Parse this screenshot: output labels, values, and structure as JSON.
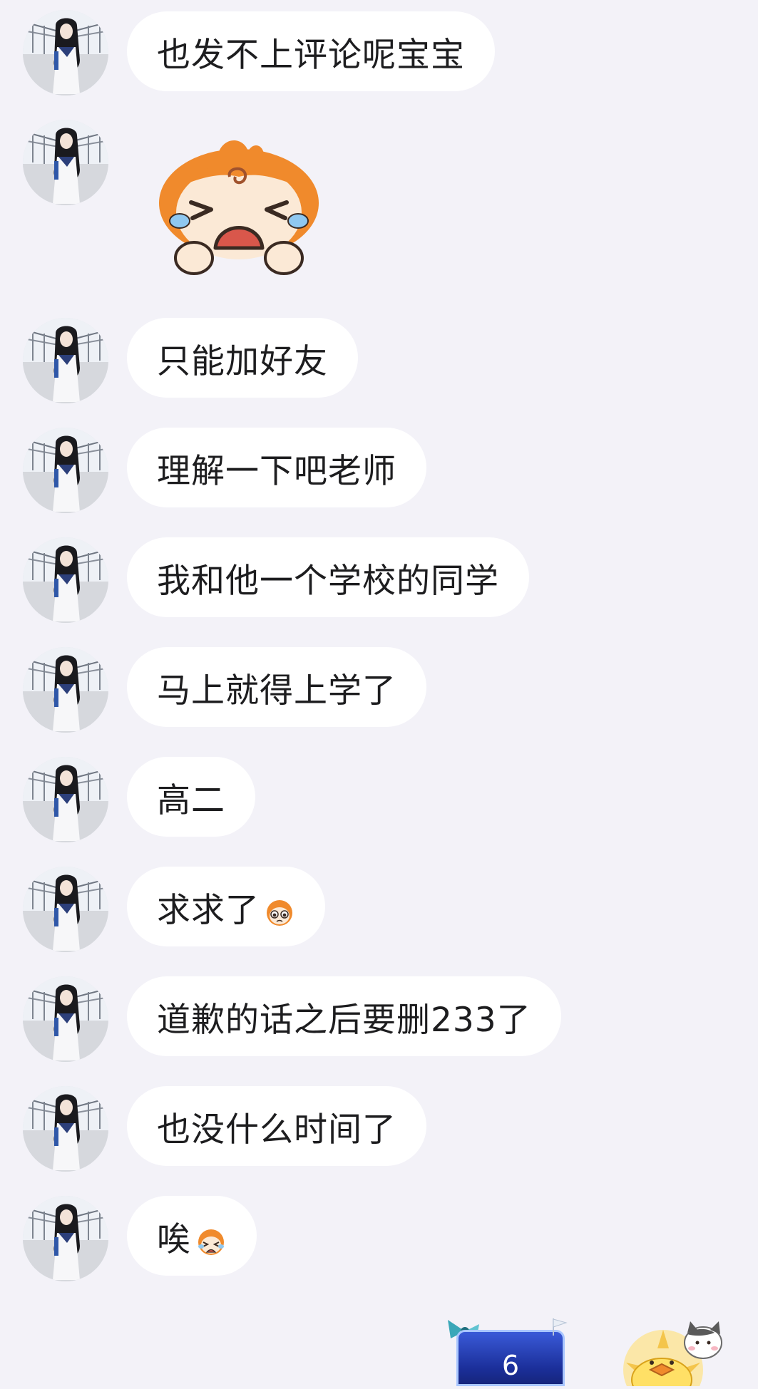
{
  "messages": [
    {
      "type": "text",
      "text": "也发不上评论呢宝宝"
    },
    {
      "type": "sticker",
      "sticker": "crying-orange-haired-character-sticker"
    },
    {
      "type": "text",
      "text": "只能加好友"
    },
    {
      "type": "text",
      "text": "理解一下吧老师"
    },
    {
      "type": "text",
      "text": "我和他一个学校的同学"
    },
    {
      "type": "text",
      "text": "马上就得上学了"
    },
    {
      "type": "text",
      "text": "高二"
    },
    {
      "type": "text",
      "text": "求求了",
      "emoji": "pleading-face-emoji"
    },
    {
      "type": "text",
      "text": "道歉的话之后要删233了"
    },
    {
      "type": "text",
      "text": "也没什么时间了"
    },
    {
      "type": "text",
      "text": "唉",
      "emoji": "crying-face-emoji"
    }
  ],
  "bottom": {
    "badge_count": "6",
    "badge_icon": "blue-level-badge-icon",
    "corner_sticker": "duck-and-cat-sticker"
  },
  "colors": {
    "background": "#f3f2f8",
    "bubble": "#ffffff",
    "text": "#1d1d1f",
    "badge": "#1b2f9a"
  }
}
